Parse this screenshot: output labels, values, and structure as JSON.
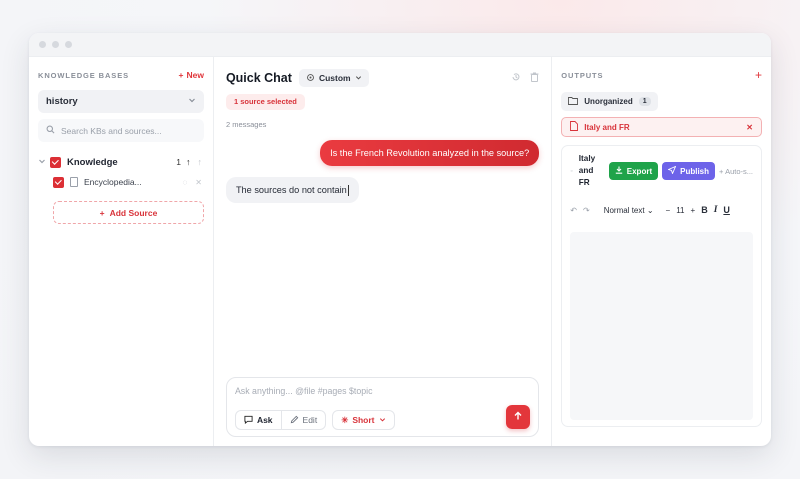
{
  "left": {
    "section_label": "KNOWLEDGE BASES",
    "new_label": "New",
    "selected_kb": "history",
    "search_placeholder": "Search KBs and sources...",
    "kb": {
      "name": "Knowledge",
      "count": "1"
    },
    "source": {
      "name": "Encyclopedia..."
    },
    "add_source_label": "Add Source"
  },
  "chat": {
    "title": "Quick Chat",
    "mode_label": "Custom",
    "source_pill": "1 source selected",
    "message_count": "2 messages",
    "messages": [
      {
        "role": "user",
        "text": "Is the French Revolution analyzed in the source?"
      },
      {
        "role": "assistant",
        "text": "The sources do not contain"
      }
    ],
    "composer_placeholder": "Ask anything... @file #pages $topic",
    "ask_label": "Ask",
    "edit_label": "Edit",
    "length_label": "Short"
  },
  "outputs": {
    "section_label": "OUTPUTS",
    "folder": {
      "name": "Unorganized",
      "count": "1"
    },
    "active_output": "Italy and FR",
    "doc": {
      "title": "Italy and FR",
      "export_label": "Export",
      "publish_label": "Publish",
      "autosave_label": "Auto-s...",
      "text_style": "Normal text",
      "font_size": "11"
    }
  },
  "colors": {
    "accent": "#e3363b",
    "export_green": "#1fa34a",
    "publish_purple": "#6d63e9"
  }
}
